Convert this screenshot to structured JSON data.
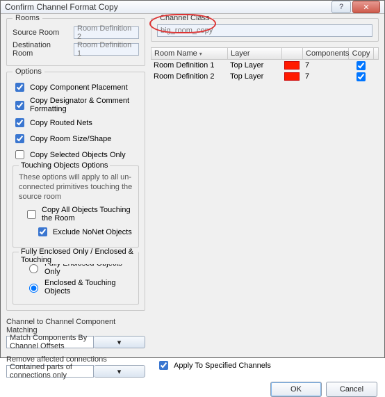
{
  "window": {
    "title": "Confirm Channel Format Copy"
  },
  "rooms": {
    "legend": "Rooms",
    "source_label": "Source Room",
    "source_value": "Room Definition 2",
    "dest_label": "Destination Room",
    "dest_value": "Room Definition 1"
  },
  "options": {
    "legend": "Options",
    "copy_component_placement": "Copy Component Placement",
    "copy_designator": "Copy Designator & Comment Formatting",
    "copy_routed_nets": "Copy Routed Nets",
    "copy_room_size": "Copy Room Size/Shape",
    "copy_selected_only": "Copy Selected Objects Only",
    "touching": {
      "legend": "Touching Objects Options",
      "note": "These options will apply to all un-connected primitives touching the source room",
      "copy_all": "Copy All Objects Touching the Room",
      "exclude_nonet": "Exclude NoNet Objects"
    },
    "enclosed": {
      "legend": "Fully Enclosed Only / Enclosed & Touching",
      "fully": "Fully Enclosed Objects Only",
      "touch": "Enclosed & Touching Objects"
    }
  },
  "matching": {
    "label": "Channel to Channel Component Matching",
    "value": "Match Components By Channel Offsets"
  },
  "remove": {
    "label": "Remove affected connections",
    "value": "Contained parts of connections only"
  },
  "channel_class": {
    "legend": "Channel Class",
    "value": "big_room_copy"
  },
  "table": {
    "headers": {
      "room": "Room Name",
      "layer": "Layer",
      "components": "Components",
      "copy": "Copy"
    },
    "rows": [
      {
        "room": "Room Definition 1",
        "layer": "Top Layer",
        "components": "7",
        "copy": true
      },
      {
        "room": "Room Definition 2",
        "layer": "Top Layer",
        "components": "7",
        "copy": true
      }
    ]
  },
  "apply_label": "Apply To Specified Channels",
  "buttons": {
    "ok": "OK",
    "cancel": "Cancel"
  }
}
